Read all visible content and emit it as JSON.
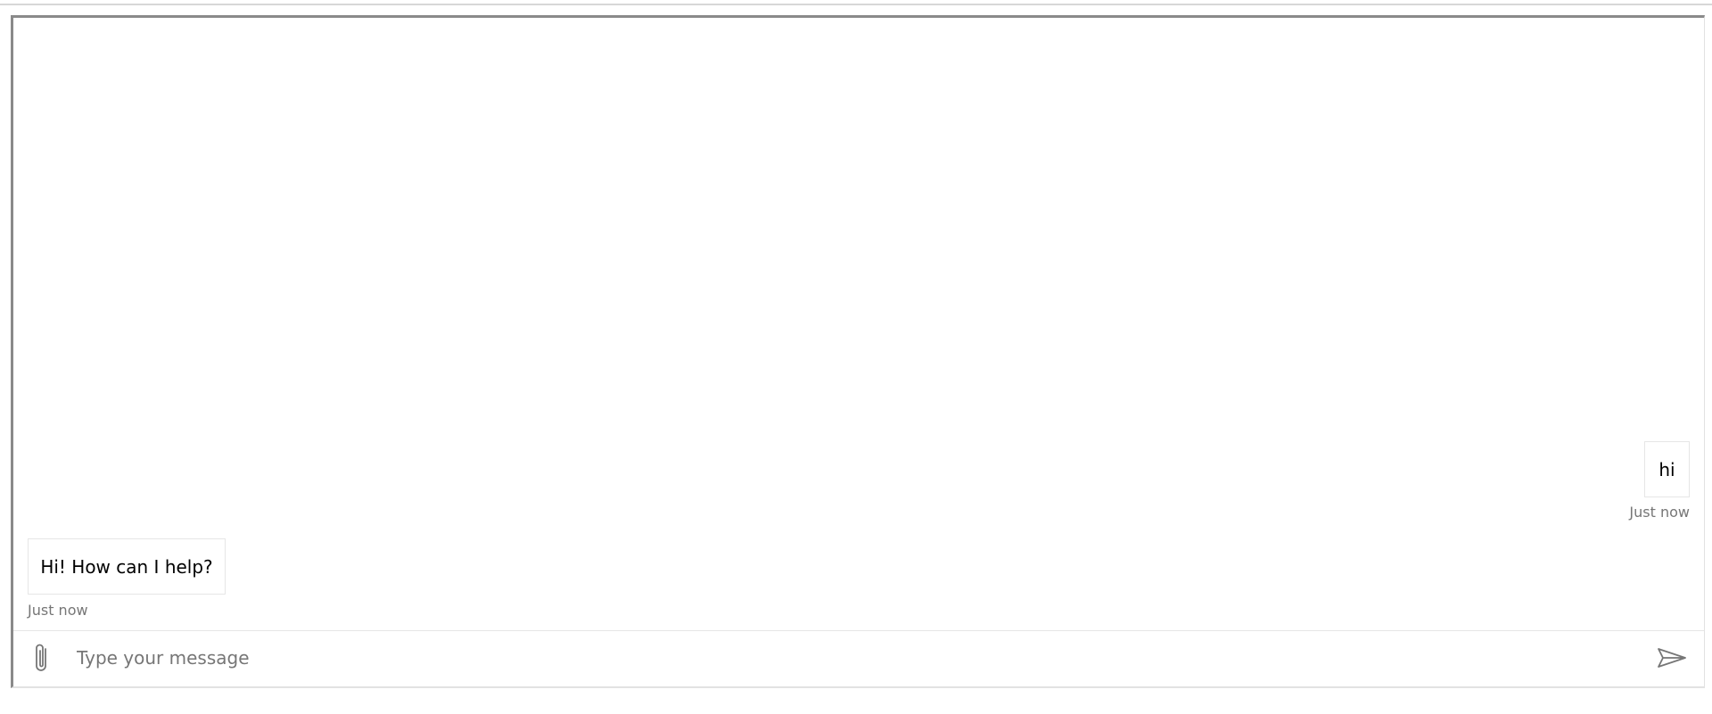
{
  "transcript": {
    "messages": [
      {
        "from": "user",
        "text": "hi",
        "timestamp": "Just now"
      },
      {
        "from": "bot",
        "text": "Hi! How can I help?",
        "timestamp": "Just now"
      }
    ]
  },
  "composer": {
    "placeholder": "Type your message",
    "value": "",
    "attach_icon": "paperclip-icon",
    "send_icon": "send-icon"
  },
  "colors": {
    "frame_border": "#8a8a8a",
    "bubble_border": "#e6e6e6",
    "muted_text": "#767676"
  }
}
